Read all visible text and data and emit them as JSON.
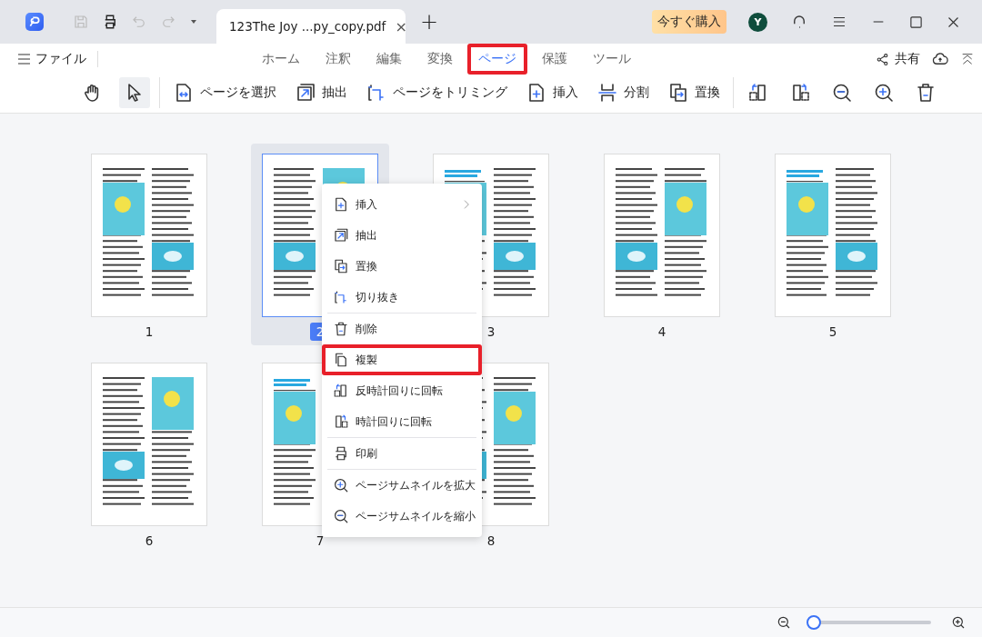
{
  "title_bar": {
    "document_tab": {
      "title": "123The Joy ...py_copy.pdf",
      "close": "×"
    },
    "new_tab": "+",
    "buy_button": "今すぐ購入",
    "avatar": "Y"
  },
  "menu_bar": {
    "file_menu": "ファイル",
    "tabs": [
      {
        "label": "ホーム",
        "selected": false,
        "annotated": false
      },
      {
        "label": "注釈",
        "selected": false,
        "annotated": false
      },
      {
        "label": "編集",
        "selected": false,
        "annotated": false
      },
      {
        "label": "変換",
        "selected": false,
        "annotated": false
      },
      {
        "label": "ページ",
        "selected": true,
        "annotated": true
      },
      {
        "label": "保護",
        "selected": false,
        "annotated": false
      },
      {
        "label": "ツール",
        "selected": false,
        "annotated": false
      }
    ],
    "share": "共有"
  },
  "toolbar": {
    "groups": [
      [
        {
          "selected": false
        },
        {
          "selected": true
        }
      ],
      [
        {
          "label": "ページを選択"
        },
        {
          "label": "抽出"
        },
        {
          "label": "ページをトリミング"
        },
        {
          "label": "挿入"
        },
        {
          "label": "分割"
        },
        {
          "label": "置換"
        }
      ],
      [
        {
          "selected": false
        },
        {
          "selected": false
        },
        {
          "selected": false
        },
        {
          "selected": false
        },
        {
          "selected": false
        }
      ]
    ]
  },
  "pages": [
    {
      "number": "1",
      "selected": false
    },
    {
      "number": "2",
      "selected": true
    },
    {
      "number": "3",
      "selected": false
    },
    {
      "number": "4",
      "selected": false
    },
    {
      "number": "5",
      "selected": false
    },
    {
      "number": "6",
      "selected": false
    },
    {
      "number": "7",
      "selected": false
    },
    {
      "number": "8",
      "selected": false
    }
  ],
  "context_menu": {
    "groups": [
      [
        {
          "label": "挿入",
          "submenu": true,
          "annotated": false
        },
        {
          "label": "抽出",
          "submenu": false,
          "annotated": false
        },
        {
          "label": "置換",
          "submenu": false,
          "annotated": false
        },
        {
          "label": "切り抜き",
          "submenu": false,
          "annotated": false
        }
      ],
      [
        {
          "label": "削除",
          "submenu": false,
          "annotated": false
        },
        {
          "label": "複製",
          "submenu": false,
          "annotated": true
        },
        {
          "label": "反時計回りに回転",
          "submenu": false,
          "annotated": false
        },
        {
          "label": "時計回りに回転",
          "submenu": false,
          "annotated": false
        }
      ],
      [
        {
          "label": "印刷",
          "submenu": false,
          "annotated": false
        }
      ],
      [
        {
          "label": "ページサムネイルを拡大",
          "submenu": false,
          "annotated": false
        },
        {
          "label": "ページサムネイルを縮小",
          "submenu": false,
          "annotated": false
        }
      ]
    ]
  },
  "status_bar": {
    "zoom_slider": {
      "level": 0.02
    }
  }
}
